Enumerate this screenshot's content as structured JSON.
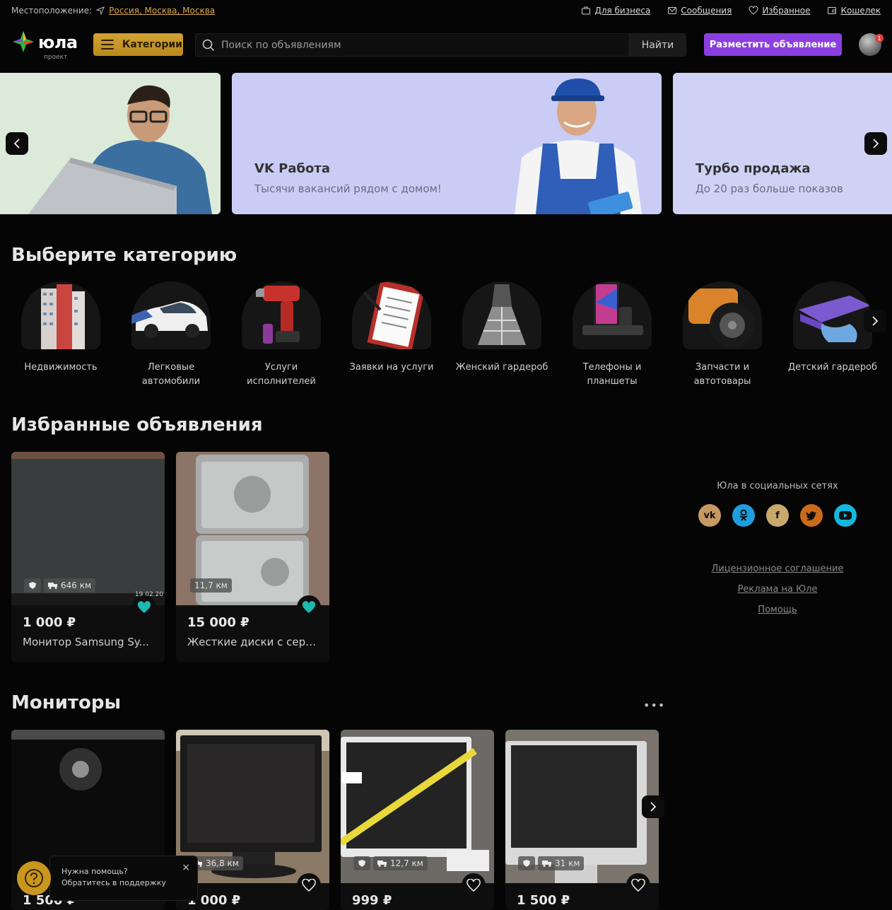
{
  "topbar": {
    "location_label": "Местоположение:",
    "location_value": "Россия, Москва, Москва",
    "links": [
      "Для бизнеса",
      "Сообщения",
      "Избранное",
      "Кошелек"
    ]
  },
  "header": {
    "logo_text": "юла",
    "logo_sub": "проект",
    "categories_label": "Категории",
    "search_placeholder": "Поиск по объявлениям",
    "search_button": "Найти",
    "post_button": "Разместить объявление",
    "notif_count": "1"
  },
  "banners": [
    {
      "title": "",
      "subtitle": ""
    },
    {
      "title": "VK Работа",
      "subtitle": "Тысячи вакансий рядом с домом!"
    },
    {
      "title": "Турбо продажа",
      "subtitle": "До 20 раз больше показов"
    }
  ],
  "categories_section": {
    "title": "Выберите категорию",
    "items": [
      "Недвижимость",
      "Легковые автомобили",
      "Услуги исполнителей",
      "Заявки на услуги",
      "Женский гардероб",
      "Телефоны и планшеты",
      "Запчасти и автотовары",
      "Детский гардероб"
    ]
  },
  "favorites_section": {
    "title": "Избранные объявления",
    "items": [
      {
        "price": "1 000 ₽",
        "title": "Монитор Samsung Sy...",
        "distance": "646 км",
        "date": "19.02.20"
      },
      {
        "price": "15 000 ₽",
        "title": "Жесткие диски с серт...",
        "distance": "11,7 км"
      }
    ]
  },
  "monitors_section": {
    "title": "Мониторы",
    "more": "•••",
    "items": [
      {
        "price": "1 500 ₽",
        "distance": ""
      },
      {
        "price": "1 000 ₽",
        "distance": "36,8 км"
      },
      {
        "price": "999 ₽",
        "distance": "12,7 км"
      },
      {
        "price": "1 500 ₽",
        "distance": "31 км"
      }
    ]
  },
  "social": {
    "title": "Юла в социальных сетях",
    "networks": [
      "vk-icon",
      "ok-icon",
      "facebook-icon",
      "twitter-icon",
      "youtube-icon"
    ],
    "links": [
      "Лицензионное соглашение",
      "Реклама на Юле",
      "Помощь"
    ]
  },
  "help": {
    "line1": "Нужна помощь?",
    "line2": "Обратитесь в поддержку",
    "close": "×"
  },
  "colors": {
    "accent": "#d3a233",
    "primary": "#8c3fe0",
    "favorite": "#1fb8b0"
  }
}
